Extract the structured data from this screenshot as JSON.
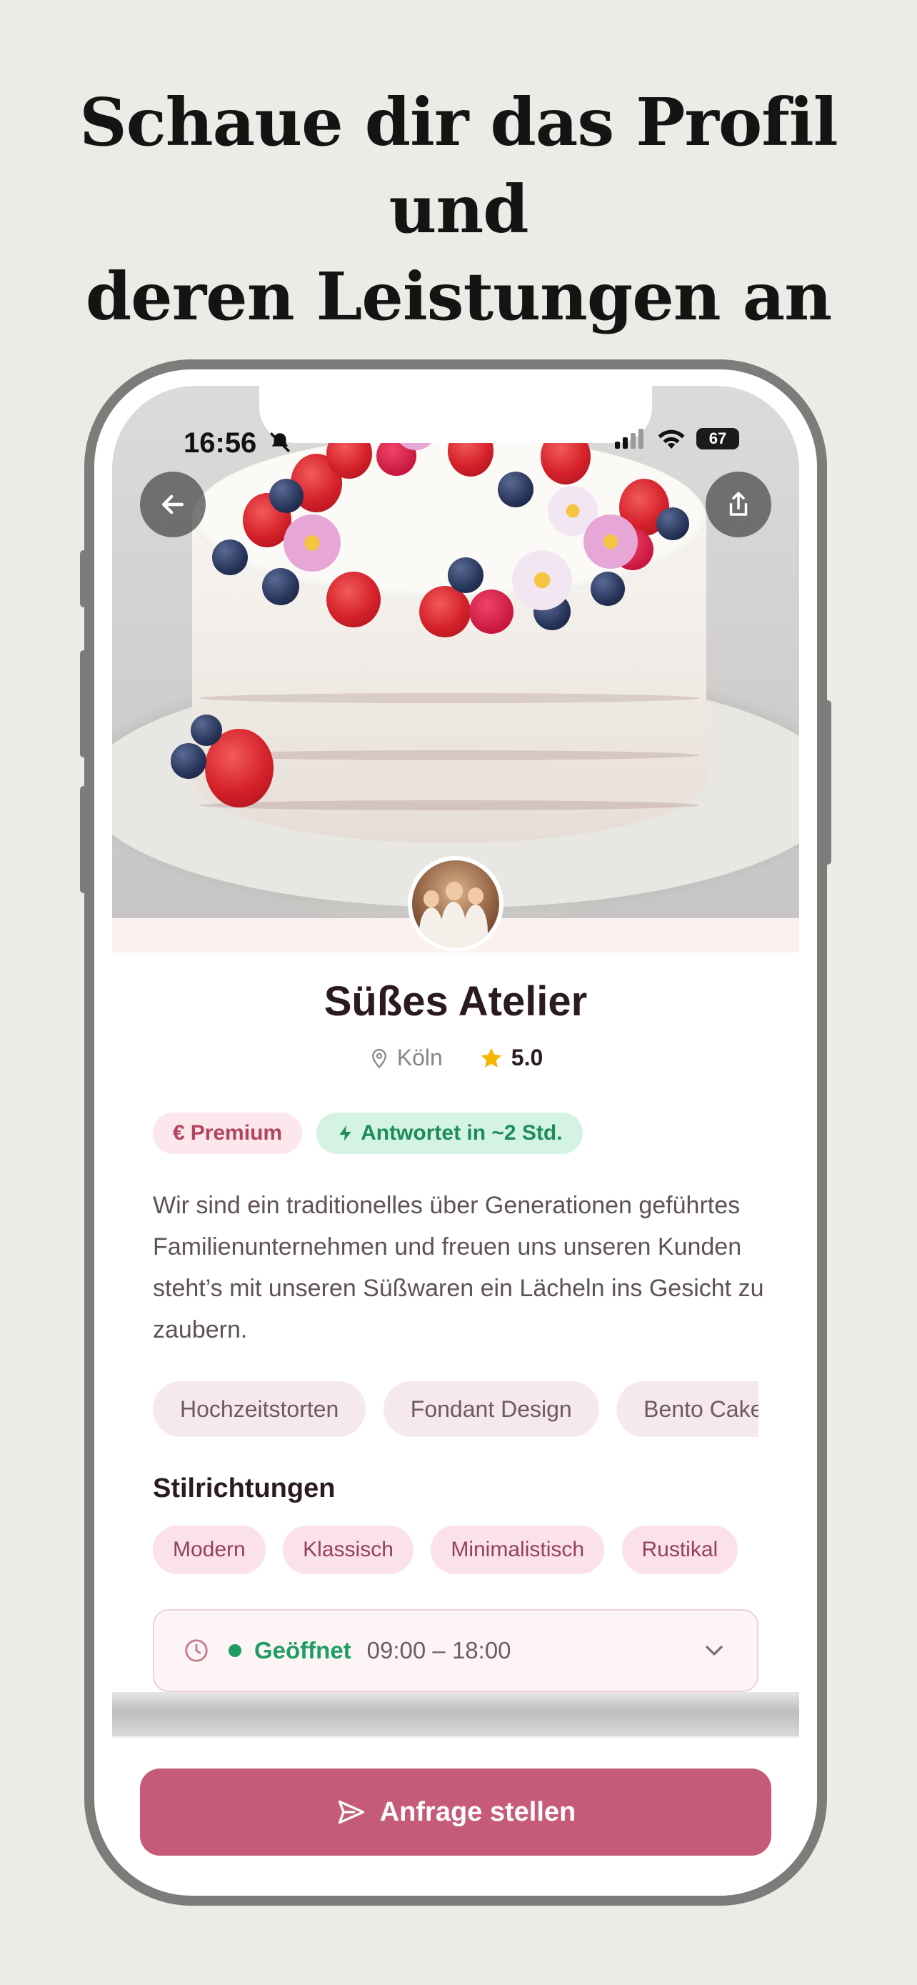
{
  "headline": {
    "line1": "Schaue dir das Profil und",
    "line2": "deren Leistungen an"
  },
  "status_bar": {
    "time": "16:56",
    "battery": "67"
  },
  "profile": {
    "name": "Süßes Atelier",
    "city": "Köln",
    "rating": "5.0",
    "badges": {
      "premium": "Premium",
      "premium_icon": "€",
      "response": "Antwortet in ~2 Std."
    },
    "description": "Wir sind ein traditionelles über Generationen geführtes Familienunternehmen und freuen uns unseren Kunden steht’s mit unseren Süßwaren ein Lächeln ins Gesicht zu zaubern.",
    "services": [
      "Hochzeitstorten",
      "Fondant Design",
      "Bento Cakes"
    ],
    "styles_title": "Stilrichtungen",
    "styles": [
      "Modern",
      "Klassisch",
      "Minimalistisch",
      "Rustikal"
    ],
    "hours": {
      "status": "Geöffnet",
      "time": "09:00 – 18:00"
    }
  },
  "cta": {
    "label": "Anfrage stellen"
  },
  "colors": {
    "accent": "#c55b79",
    "open_green": "#1e9c63",
    "background": "#ecebe6"
  },
  "icons": [
    "back-arrow-icon",
    "share-icon",
    "location-pin-icon",
    "star-icon",
    "lightning-icon",
    "clock-icon",
    "chevron-down-icon",
    "send-icon",
    "bell-slash-icon",
    "signal-icon",
    "wifi-icon"
  ]
}
